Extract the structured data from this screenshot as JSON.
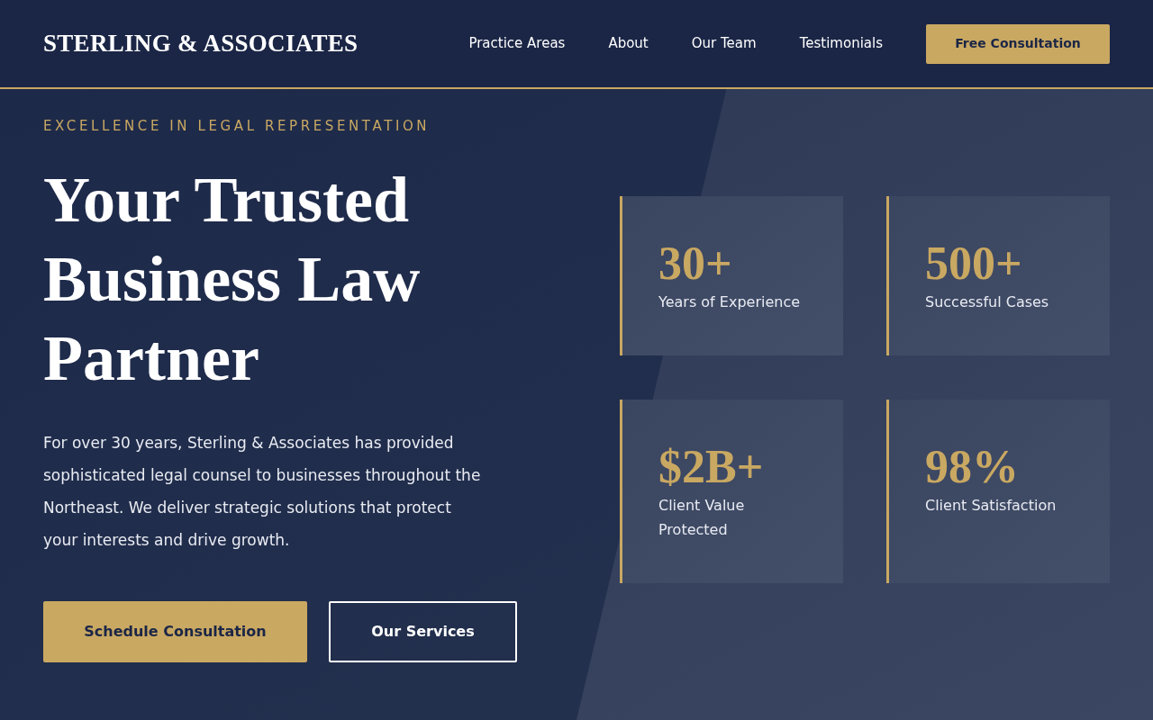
{
  "header": {
    "logo": "STERLING & ASSOCIATES",
    "nav": [
      "Practice Areas",
      "About",
      "Our Team",
      "Testimonials"
    ],
    "cta": "Free Consultation"
  },
  "hero": {
    "eyebrow": "EXCELLENCE IN LEGAL REPRESENTATION",
    "title": "Your Trusted Business Law Partner",
    "description": "For over 30 years, Sterling & Associates has provided sophisticated legal counsel to businesses throughout the Northeast. We deliver strategic solutions that protect your interests and drive growth.",
    "buttons": [
      {
        "label": "Schedule Consultation",
        "kind": "primary"
      },
      {
        "label": "Our Services",
        "kind": "outline"
      }
    ]
  },
  "stats": [
    {
      "value": "30+",
      "label": "Years of Experience"
    },
    {
      "value": "500+",
      "label": "Successful Cases"
    },
    {
      "value": "$2B+",
      "label": "Client Value Protected"
    },
    {
      "value": "98%",
      "label": "Client Satisfaction"
    }
  ]
}
